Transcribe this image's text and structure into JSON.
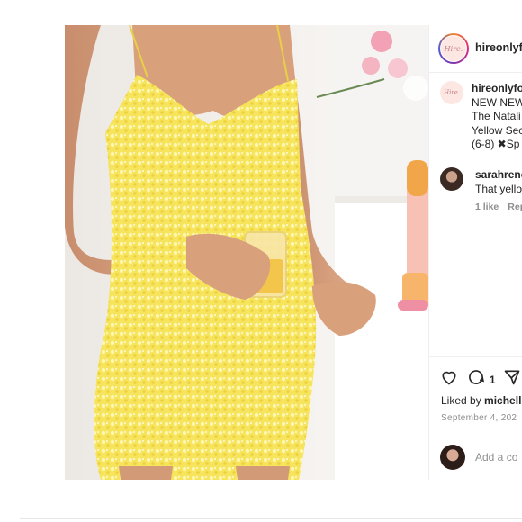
{
  "post": {
    "username": "hireonlyfo",
    "avatar_text": "Hire.",
    "caption": {
      "username": "hireonlyfo",
      "lines": [
        "NEW NEW",
        "The Natali",
        "Yellow Sec",
        "(6-8) ✖Sp"
      ]
    },
    "comment": {
      "username": "sarahrene",
      "text": "That yello",
      "likes": "1 like",
      "reply": "Rep"
    },
    "actions": {
      "like_icon": "heart-icon",
      "comment_icon": "comment-icon",
      "share_icon": "share-icon",
      "comment_count": "1"
    },
    "liked_by_prefix": "Liked by",
    "liked_by_user": "michell",
    "date": "September 4, 202",
    "add_comment_placeholder": "Add a co"
  },
  "colors": {
    "dress": "#f4e257",
    "text": "#262626",
    "muted": "#8e8e8e",
    "border": "#efefef"
  }
}
